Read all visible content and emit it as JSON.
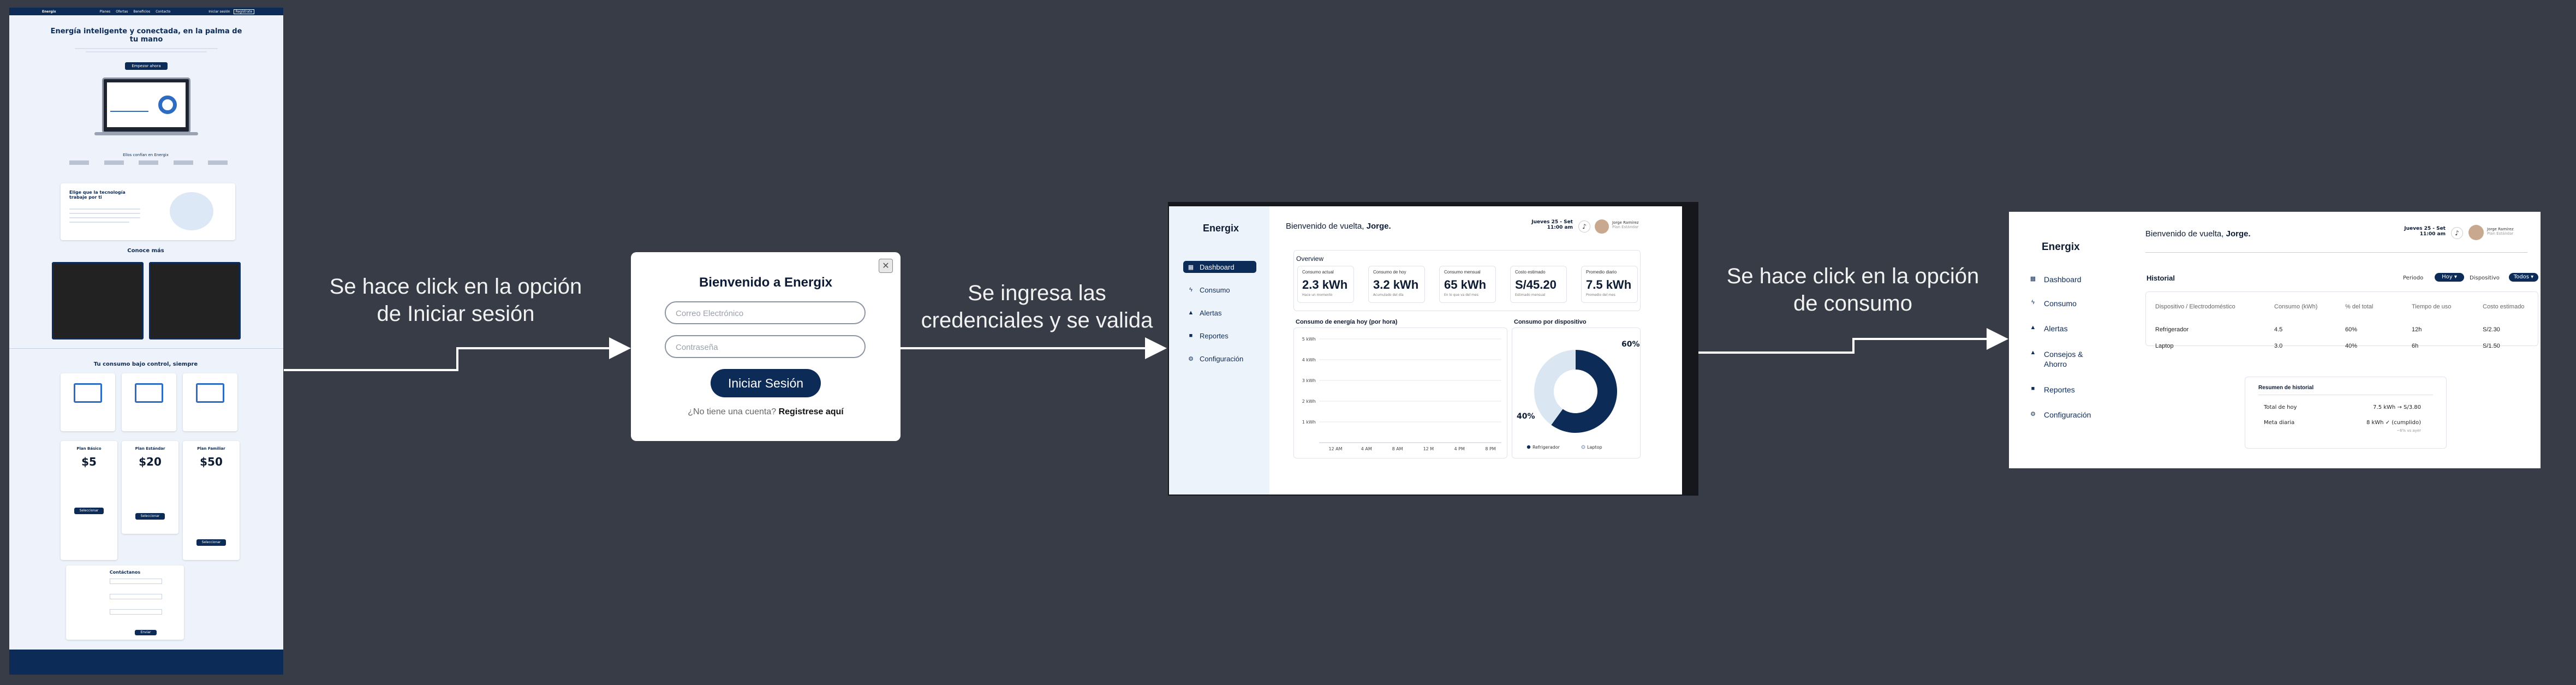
{
  "steps": [
    {
      "caption": "Se hace click en la opción de Iniciar sesión"
    },
    {
      "caption": "Se ingresa las credenciales y se valida"
    },
    {
      "caption": "Se hace click en la opción de consumo"
    }
  ],
  "landing": {
    "brand": "Energix",
    "nav": [
      "Planes",
      "Ofertas",
      "Beneficios",
      "Contacto"
    ],
    "login_link": "Iniciar sesión",
    "register": "Regístrate",
    "hero_title": "Energía inteligente y conectada, en la palma de tu mano",
    "hero_cta": "Empezar ahora",
    "sponsors_title": "Ellos confían en Energix",
    "about_title": "Elige que la tecnología trabaje por ti",
    "more_title": "Conoce más",
    "plans_title": "Tu consumo bajo control, siempre",
    "plans": [
      {
        "name": "Plan Básico",
        "price": "$5",
        "cta": "Seleccionar"
      },
      {
        "name": "Plan Estándar",
        "price": "$20",
        "cta": "Seleccionar"
      },
      {
        "name": "Plan Familiar",
        "price": "$50",
        "cta": "Seleccionar"
      }
    ],
    "contact_title": "Contáctanos",
    "contact_button": "Enviar"
  },
  "login": {
    "title": "Bienvenido a Energix",
    "email_placeholder": "Correo Electrónico",
    "password_placeholder": "Contraseña",
    "submit": "Iniciar Sesión",
    "no_account": "¿No tiene una cuenta?",
    "register_link": "Registrese aquí",
    "close_icon": "close-icon"
  },
  "dashboard": {
    "brand": "Energix",
    "welcome": "Bienvenido de vuelta,",
    "user_first": "Jorge.",
    "date": "Jueves 25 - Set",
    "time": "11:00 am",
    "user_name": "Jorge Ramírez",
    "user_role": "Plan Estándar",
    "nav": [
      {
        "label": "Dashboard",
        "icon": "grid-icon",
        "active": true
      },
      {
        "label": "Consumo",
        "icon": "bolt-icon",
        "active": false
      },
      {
        "label": "Alertas",
        "icon": "warning-icon",
        "active": false
      },
      {
        "label": "Reportes",
        "icon": "folder-icon",
        "active": false
      },
      {
        "label": "Configuración",
        "icon": "gear-icon",
        "active": false
      }
    ],
    "overview_title": "Overview",
    "kpis": [
      {
        "title": "Consumo actual",
        "value": "2.3 kWh",
        "sub": "Hace un momento"
      },
      {
        "title": "Consumo de hoy",
        "value": "3.2 kWh",
        "sub": "Acumulado del día"
      },
      {
        "title": "Consumo mensual",
        "value": "65 kWh",
        "sub": "En lo que va del mes"
      },
      {
        "title": "Costo estimado",
        "value": "S/45.20",
        "sub": "Estimado mensual"
      },
      {
        "title": "Promedio diario",
        "value": "7.5 kWh",
        "sub": "Promedio del mes"
      }
    ],
    "line_title": "Consumo de energía hoy (por hora)",
    "pie_title": "Consumo por dispositivo"
  },
  "consumo": {
    "brand": "Energix",
    "welcome": "Bienvenido de vuelta,",
    "user_first": "Jorge.",
    "date": "Jueves 25 - Set",
    "time": "11:00 am",
    "user_name": "Jorge Ramírez",
    "user_role": "Plan Estándar",
    "nav": [
      {
        "label": "Dashboard",
        "icon": "grid-icon"
      },
      {
        "label": "Consumo",
        "icon": "bolt-icon"
      },
      {
        "label": "Alertas",
        "icon": "warning-icon"
      },
      {
        "label": "Consejos & Ahorro",
        "icon": "warning-icon"
      },
      {
        "label": "Reportes",
        "icon": "folder-icon"
      },
      {
        "label": "Configuración",
        "icon": "gear-icon"
      }
    ],
    "section_title": "Historial",
    "period_label": "Periodo",
    "period_value": "Hoy",
    "device_label": "Dispositivo",
    "device_value": "Todos",
    "table_headers": [
      "Dispositivo / Electrodoméstico",
      "Consumo (kWh)",
      "% del total",
      "Tiempo de uso",
      "Costo estimado"
    ],
    "table_rows": [
      [
        "Refrigerador",
        "4.5",
        "60%",
        "12h",
        "S/2.30"
      ],
      [
        "Laptop",
        "3.0",
        "40%",
        "6h",
        "S/1.50"
      ]
    ],
    "summary_title": "Resumen de historial",
    "summary": [
      {
        "label": "Total de hoy",
        "value": "7.5 kWh → S/3.80",
        "note": ""
      },
      {
        "label": "Meta diaria",
        "value": "8 kWh ✓ (cumplido)",
        "note": "−6% vs ayer"
      }
    ]
  },
  "chart_data": [
    {
      "type": "line",
      "title": "Consumo de energía hoy (por hora)",
      "x": [
        "12 AM",
        "4 AM",
        "8 AM",
        "12 M",
        "4 PM",
        "8 PM"
      ],
      "y_ticks": [
        "1 kWh",
        "2 kWh",
        "3 kWh",
        "4 kWh",
        "5 kWh"
      ],
      "ylim": [
        0,
        5
      ],
      "series": [],
      "grid": true
    },
    {
      "type": "pie",
      "title": "Consumo por dispositivo",
      "labels": [
        "Refrigerador",
        "Laptop"
      ],
      "values": [
        60,
        40
      ],
      "value_labels": [
        "60%",
        "40%"
      ],
      "colors": [
        "#0d2b57",
        "#dbe6f3"
      ],
      "legend": "bottom"
    }
  ],
  "colors": {
    "background": "#383c47",
    "navy": "#0d2b57",
    "light": "#edf3fb"
  }
}
